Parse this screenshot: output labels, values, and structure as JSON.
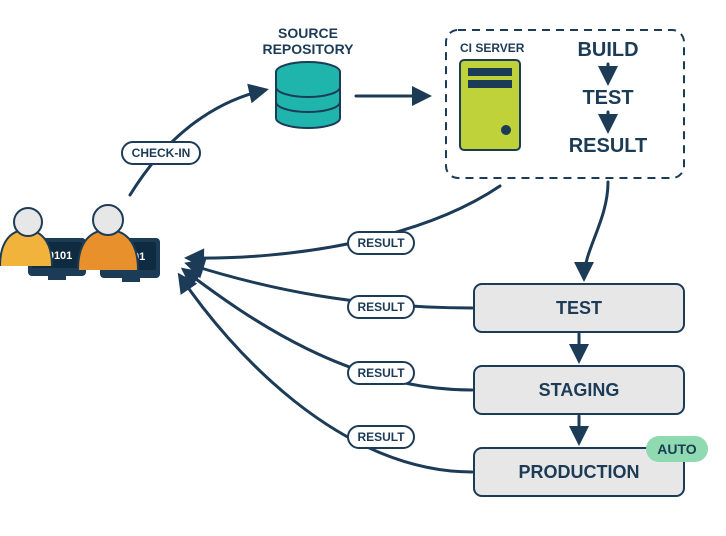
{
  "labels": {
    "source_repo_line1": "SOURCE",
    "source_repo_line2": "REPOSITORY",
    "ci_server": "CI SERVER",
    "build": "BUILD",
    "test_step": "TEST",
    "result_step": "RESULT",
    "checkin": "CHECK-IN",
    "result": "RESULT",
    "auto": "AUTO"
  },
  "stages": {
    "test": "TEST",
    "staging": "STAGING",
    "production": "PRODUCTION"
  },
  "dev_screen": "10101"
}
